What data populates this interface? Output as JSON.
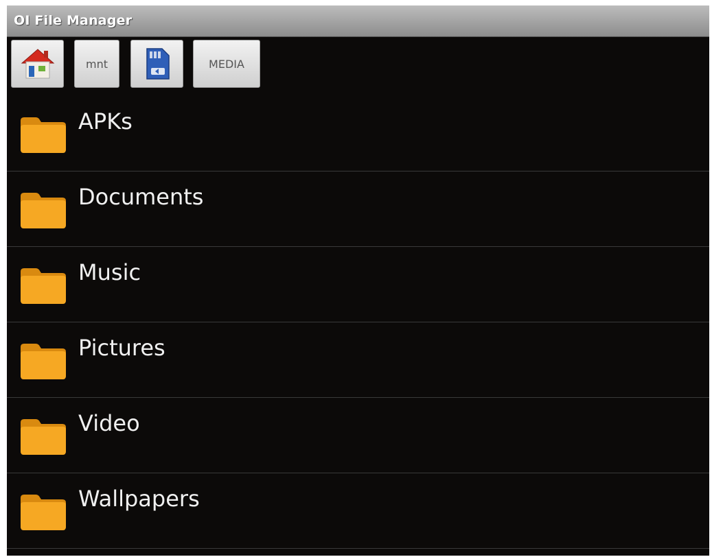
{
  "app": {
    "title": "OI File Manager"
  },
  "path": {
    "crumbs": [
      {
        "label": "",
        "icon": "home-icon"
      },
      {
        "label": "mnt"
      },
      {
        "label": "",
        "icon": "sdcard-icon"
      },
      {
        "label": "MEDIA"
      }
    ]
  },
  "folders": [
    {
      "name": "APKs",
      "icon": "folder-icon"
    },
    {
      "name": "Documents",
      "icon": "folder-icon"
    },
    {
      "name": "Music",
      "icon": "folder-icon"
    },
    {
      "name": "Pictures",
      "icon": "folder-icon"
    },
    {
      "name": "Video",
      "icon": "folder-icon"
    },
    {
      "name": "Wallpapers",
      "icon": "folder-icon"
    }
  ],
  "colors": {
    "background": "#0c0a09",
    "folder": "#f2a51c",
    "text": "#f0f0f0"
  }
}
